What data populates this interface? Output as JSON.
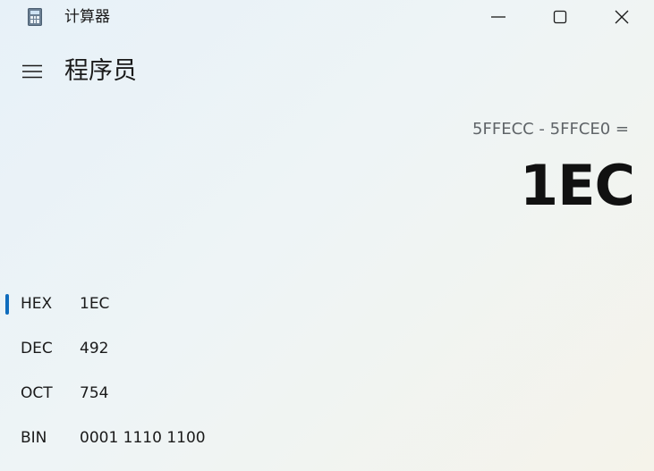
{
  "window": {
    "title": "计算器",
    "app_icon": "calculator-icon",
    "controls": [
      "minimize-icon",
      "maximize-icon",
      "close-icon"
    ]
  },
  "header": {
    "menu_icon": "hamburger-menu-icon",
    "mode_title": "程序员"
  },
  "display": {
    "expression": "5FFECC - 5FFCE0 =",
    "result": "1EC"
  },
  "radix": {
    "selected": "HEX",
    "accent_color": "#0f6cbd",
    "rows": [
      {
        "label": "HEX",
        "value": "1EC"
      },
      {
        "label": "DEC",
        "value": "492"
      },
      {
        "label": "OCT",
        "value": "754"
      },
      {
        "label": "BIN",
        "value": "0001 1110 1100"
      }
    ]
  }
}
